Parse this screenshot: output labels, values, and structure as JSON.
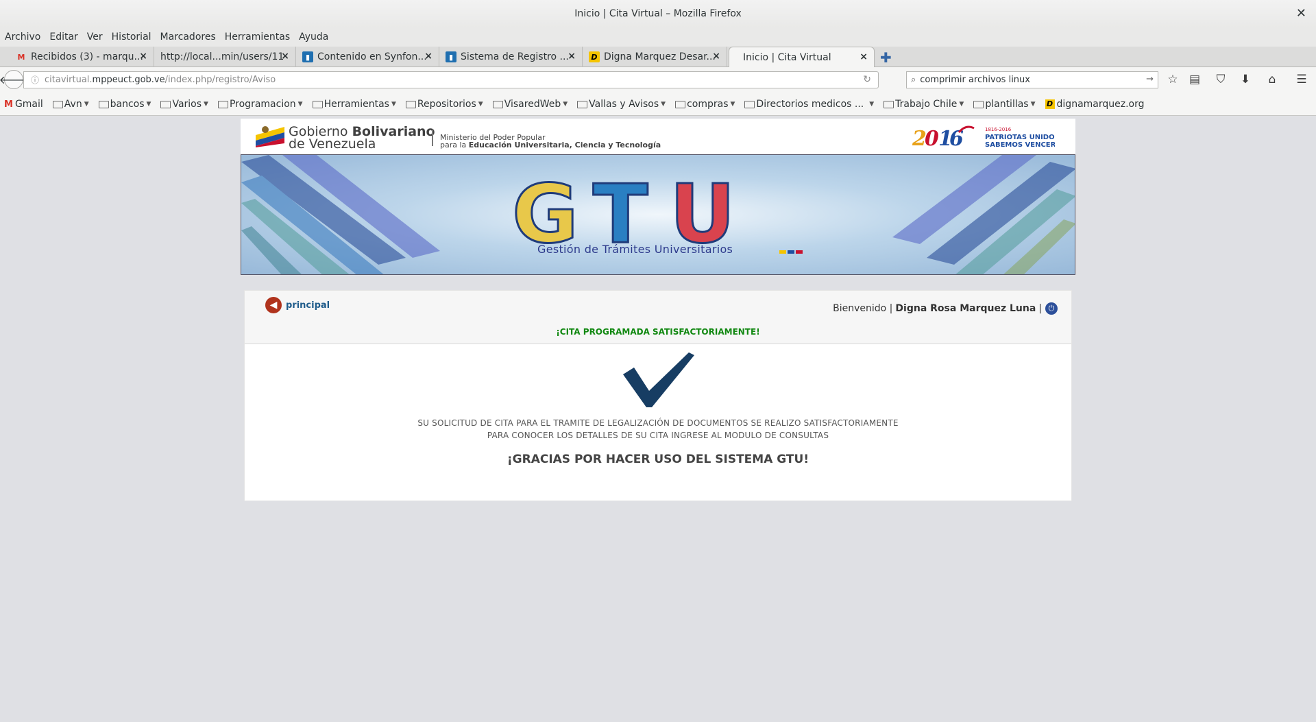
{
  "window": {
    "title": "Inicio | Cita Virtual – Mozilla Firefox"
  },
  "menubar": [
    "Archivo",
    "Editar",
    "Ver",
    "Historial",
    "Marcadores",
    "Herramientas",
    "Ayuda"
  ],
  "tabs": [
    {
      "label": "Recibidos (3) - marqu...",
      "icon": "gmail-icon"
    },
    {
      "label": "http://local...min/users/11",
      "icon": ""
    },
    {
      "label": "Contenido en Synfon...",
      "icon": "trello-icon"
    },
    {
      "label": "Sistema de Registro ...",
      "icon": "trello-icon"
    },
    {
      "label": "Digna Marquez Desar...",
      "icon": "d-logo-icon"
    },
    {
      "label": "Inicio | Cita Virtual",
      "icon": ""
    }
  ],
  "url": {
    "prefix": "citavirtual.",
    "domain": "mppeuct.gob.ve",
    "path": "/index.php/registro/Aviso"
  },
  "search": {
    "value": "comprimir archivos linux"
  },
  "bookmarks": [
    {
      "label": "Gmail",
      "type": "gmail"
    },
    {
      "label": "Avn",
      "type": "folder"
    },
    {
      "label": "bancos",
      "type": "folder"
    },
    {
      "label": "Varios",
      "type": "folder"
    },
    {
      "label": "Programacion",
      "type": "folder"
    },
    {
      "label": "Herramientas",
      "type": "folder"
    },
    {
      "label": "Repositorios",
      "type": "folder"
    },
    {
      "label": "VisaredWeb",
      "type": "folder"
    },
    {
      "label": "Vallas y Avisos",
      "type": "folder"
    },
    {
      "label": "compras",
      "type": "folder"
    },
    {
      "label": "Directorios medicos ...",
      "type": "folder"
    },
    {
      "label": "Trabajo Chile",
      "type": "folder"
    },
    {
      "label": "plantillas",
      "type": "folder"
    },
    {
      "label": "dignamarquez.org",
      "type": "link"
    }
  ],
  "gov": {
    "line1_a": "Gobierno ",
    "line1_b": "Bolivariano",
    "line2": "de Venezuela",
    "ministry1": "Ministerio del Poder Popular",
    "ministry2_a": "para la ",
    "ministry2_b": "Educación Universitaria, Ciencia y Tecnología",
    "bicentenario_years": "1816-2016",
    "bicentenario_1": "PATRIOTAS UNIDOS",
    "bicentenario_2": "SABEMOS VENCER"
  },
  "banner": {
    "logo_text": "GTU",
    "subtitle": "Gestión de Trámites Universitarios"
  },
  "card": {
    "back_label": "principal",
    "welcome_prefix": "Bienvenido |",
    "user_name": "Digna Rosa Marquez Luna",
    "welcome_sep": "|",
    "success": "¡CITA PROGRAMADA SATISFACTORIAMENTE!",
    "message_line1": "SU SOLICITUD DE CITA PARA EL TRAMITE DE LEGALIZACIÓN DE DOCUMENTOS SE REALIZO SATISFACTORIAMENTE",
    "message_line2": "PARA CONOCER LOS DETALLES DE SU CITA INGRESE AL MODULO DE CONSULTAS",
    "thanks": "¡GRACIAS POR HACER USO DEL SISTEMA GTU!"
  },
  "colors": {
    "success_green": "#118811",
    "link_blue": "#1f5c8b",
    "check_navy": "#173d63"
  }
}
